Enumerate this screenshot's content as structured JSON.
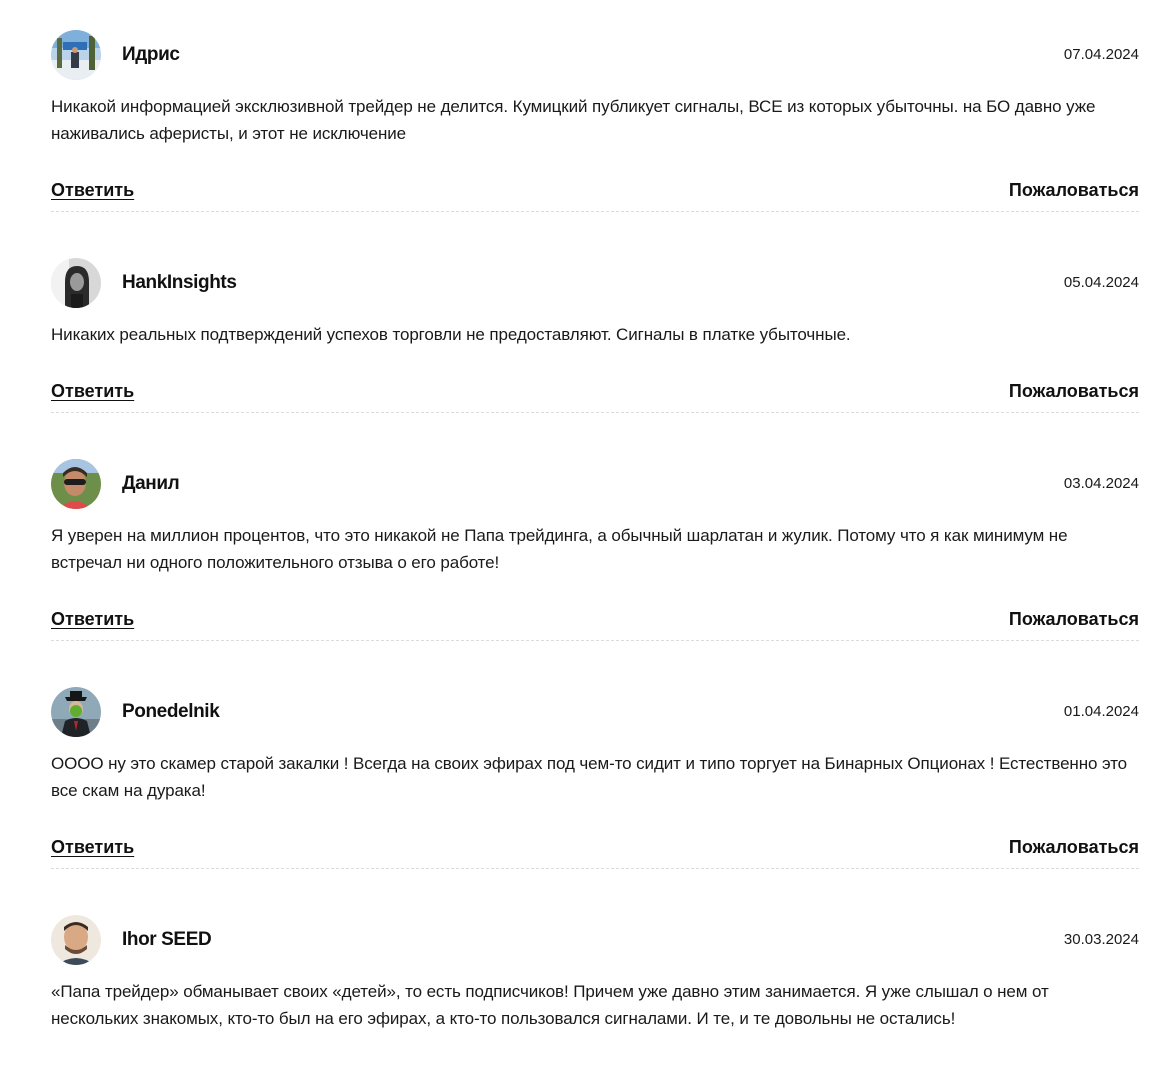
{
  "comments": [
    {
      "author": "Идрис",
      "date": "07.04.2024",
      "avatar_icon": "person-outdoor-photo",
      "text": "Никакой информацией эксклюзивной трейдер не делится. Кумицкий публикует сигналы, ВСЕ из которых убыточны. на БО давно уже наживались аферисты, и этот не исключение",
      "reply_label": "Ответить",
      "report_label": "Пожаловаться"
    },
    {
      "author": "HankInsights",
      "date": "05.04.2024",
      "avatar_icon": "bw-portrait-photo",
      "text": "Никаких реальных подтверждений успехов торговли не предоставляют. Сигналы в платке убыточные.",
      "reply_label": "Ответить",
      "report_label": "Пожаловаться"
    },
    {
      "author": "Данил",
      "date": "03.04.2024",
      "avatar_icon": "man-sunglasses-photo",
      "text": "Я уверен на миллион процентов, что это никакой не Папа трейдинга, а обычный шарлатан и жулик. Потому что я как минимум не встречал ни одного положительного отзыва о его работе!",
      "reply_label": "Ответить",
      "report_label": "Пожаловаться"
    },
    {
      "author": "Ponedelnik",
      "date": "01.04.2024",
      "avatar_icon": "man-with-apple-painting",
      "text": "ОООО ну это скамер старой закалки ! Всегда на своих эфирах под чем-то сидит и типо торгует на Бинарных Опционах ! Естественно это все скам на дурака!",
      "reply_label": "Ответить",
      "report_label": "Пожаловаться"
    },
    {
      "author": "Ihor SEED",
      "date": "30.03.2024",
      "avatar_icon": "man-portrait-photo",
      "text": "«Папа трейдер» обманывает своих «детей», то есть подписчиков! Причем уже давно этим занимается. Я уже слышал о нем от нескольких знакомых, кто-то был на его эфирах, а кто-то пользовался сигналами. И те, и те довольны не остались!"
    }
  ]
}
